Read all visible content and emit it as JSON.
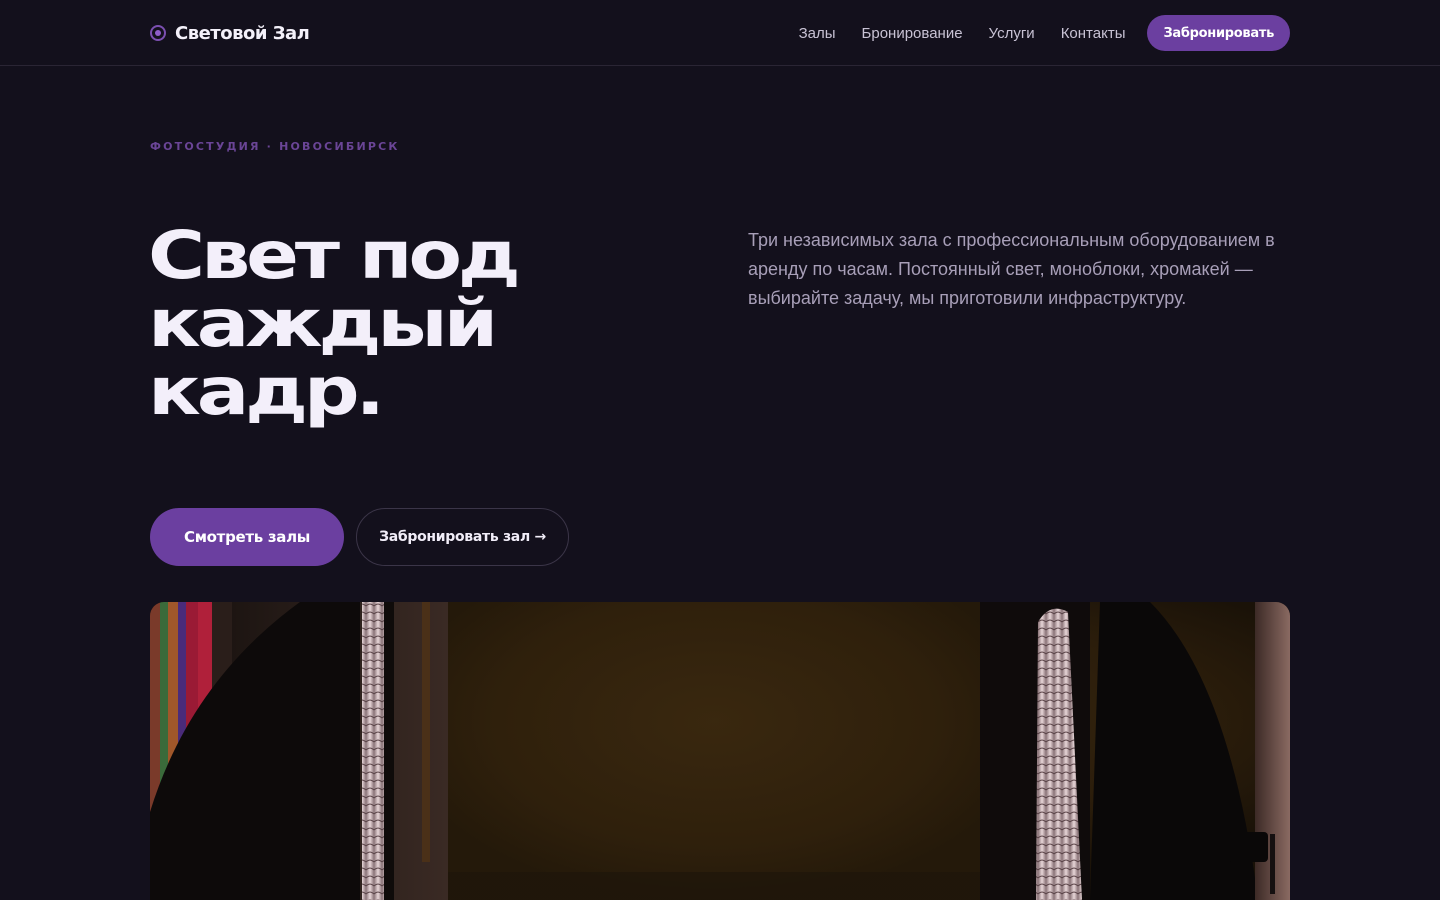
{
  "header": {
    "brand": "Световой Зал",
    "nav": [
      "Залы",
      "Бронирование",
      "Услуги",
      "Контакты"
    ],
    "cta_label": "Забронировать"
  },
  "hero": {
    "eyebrow": "ФОТОСТУДИЯ · НОВОСИБИРСК",
    "title_lines": [
      "Свет под",
      "каждый",
      "кадр."
    ],
    "description": "Три независимых зала с профессиональным оборудованием в аренду по часам. Постоянный свет, моноблоки, хромакей — выбирайте задачу, мы приготовили инфраструктуру.",
    "primary_button": "Смотреть залы",
    "secondary_button": "Забронировать зал →"
  },
  "colors": {
    "background": "#13101c",
    "accent": "#6b3fa0",
    "text": "#f3effa",
    "muted_text": "#a89fb8"
  },
  "icons": {
    "brand": "ring-dot-icon"
  }
}
